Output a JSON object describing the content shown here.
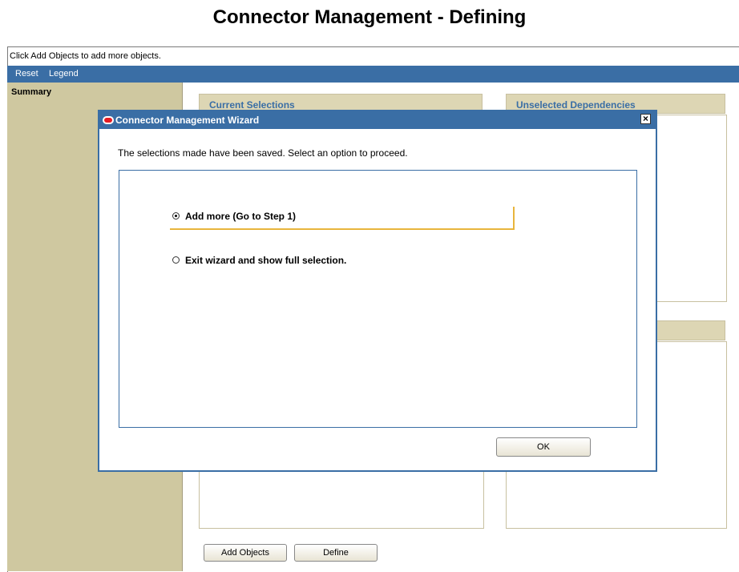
{
  "page_title": "Connector Management - Defining",
  "hint_text": "Click Add Objects to add more objects.",
  "menu": {
    "reset": "Reset",
    "legend": "Legend"
  },
  "sidebar": {
    "title": "Summary"
  },
  "panels": {
    "current_selections": "Current Selections",
    "unselected_dependencies": "Unselected Dependencies"
  },
  "buttons": {
    "add_objects": "Add Objects",
    "define": "Define"
  },
  "modal": {
    "title": "Connector Management Wizard",
    "message": "The selections made have been saved. Select an option to proceed.",
    "options": [
      {
        "label": "Add more (Go to Step 1)",
        "selected": true
      },
      {
        "label": "Exit wizard and show full selection.",
        "selected": false
      }
    ],
    "ok_label": "OK"
  },
  "icons": {
    "logo": "oracle-logo-icon",
    "close": "close-icon"
  },
  "colors": {
    "accent": "#3a6ea5",
    "sidebar": "#cfc8a0",
    "highlight": "#e8b53c"
  }
}
